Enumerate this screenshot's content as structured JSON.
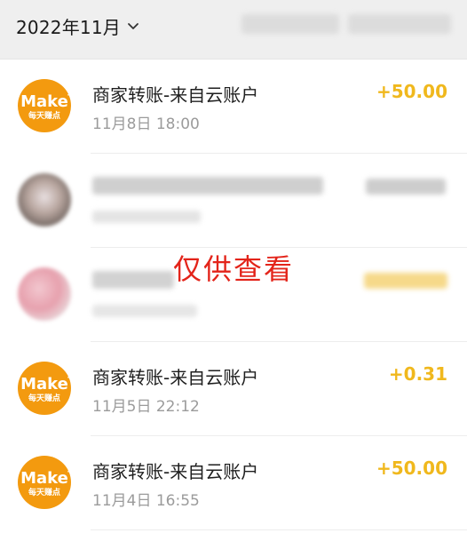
{
  "header": {
    "month_label": "2022年11月",
    "chevron_icon": "chevron-down-icon"
  },
  "colors": {
    "amount": "#f0b81d",
    "logo": "#f39a0f",
    "header_bg": "#efefef",
    "watermark": "#e3241a"
  },
  "transactions": [
    {
      "avatar": "make-logo",
      "logo_word": "Make",
      "logo_sub": "每天赚点",
      "title": "商家转账-来自云账户",
      "time": "11月8日 18:00",
      "amount": "+50.00"
    },
    {
      "avatar": "blurred-photo",
      "blurred": true
    },
    {
      "avatar": "blurred-photo",
      "blurred": true
    },
    {
      "avatar": "make-logo",
      "logo_word": "Make",
      "logo_sub": "每天赚点",
      "title": "商家转账-来自云账户",
      "time": "11月5日 22:12",
      "amount": "+0.31"
    },
    {
      "avatar": "make-logo",
      "logo_word": "Make",
      "logo_sub": "每天赚点",
      "title": "商家转账-来自云账户",
      "time": "11月4日 16:55",
      "amount": "+50.00"
    }
  ],
  "watermark": "仅供查看"
}
